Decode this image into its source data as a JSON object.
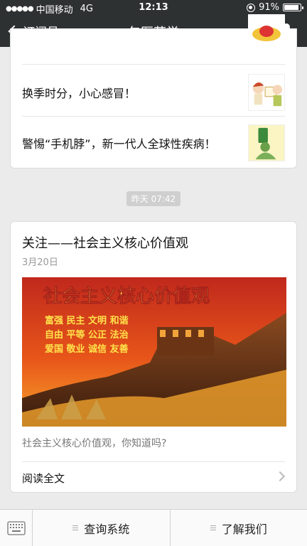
{
  "status": {
    "carrier": "中国移动",
    "network": "4G",
    "time": "12:13",
    "battery": "91%",
    "battery_level": 0.91
  },
  "nav": {
    "back_label": "订阅号",
    "title": "包医药学"
  },
  "card1": {
    "items": [
      {
        "title": "换季时分，小心感冒！"
      },
      {
        "title": "警惕“手机脖”，新一代人全球性疾病！"
      }
    ]
  },
  "time_label": "昨天 07:42",
  "card2": {
    "title": "关注——社会主义核心价值观",
    "date": "3月20日",
    "image": {
      "headline": "社会主义核心价值观",
      "lines": [
        "富强 民主 文明 和谐",
        "自由 平等 公正 法治",
        "爱国 敬业 诚信 友善"
      ]
    },
    "description": "社会主义核心价值观，你知道吗?",
    "read_more": "阅读全文"
  },
  "bottom_menu": [
    {
      "label": "查询系统"
    },
    {
      "label": "了解我们"
    }
  ]
}
